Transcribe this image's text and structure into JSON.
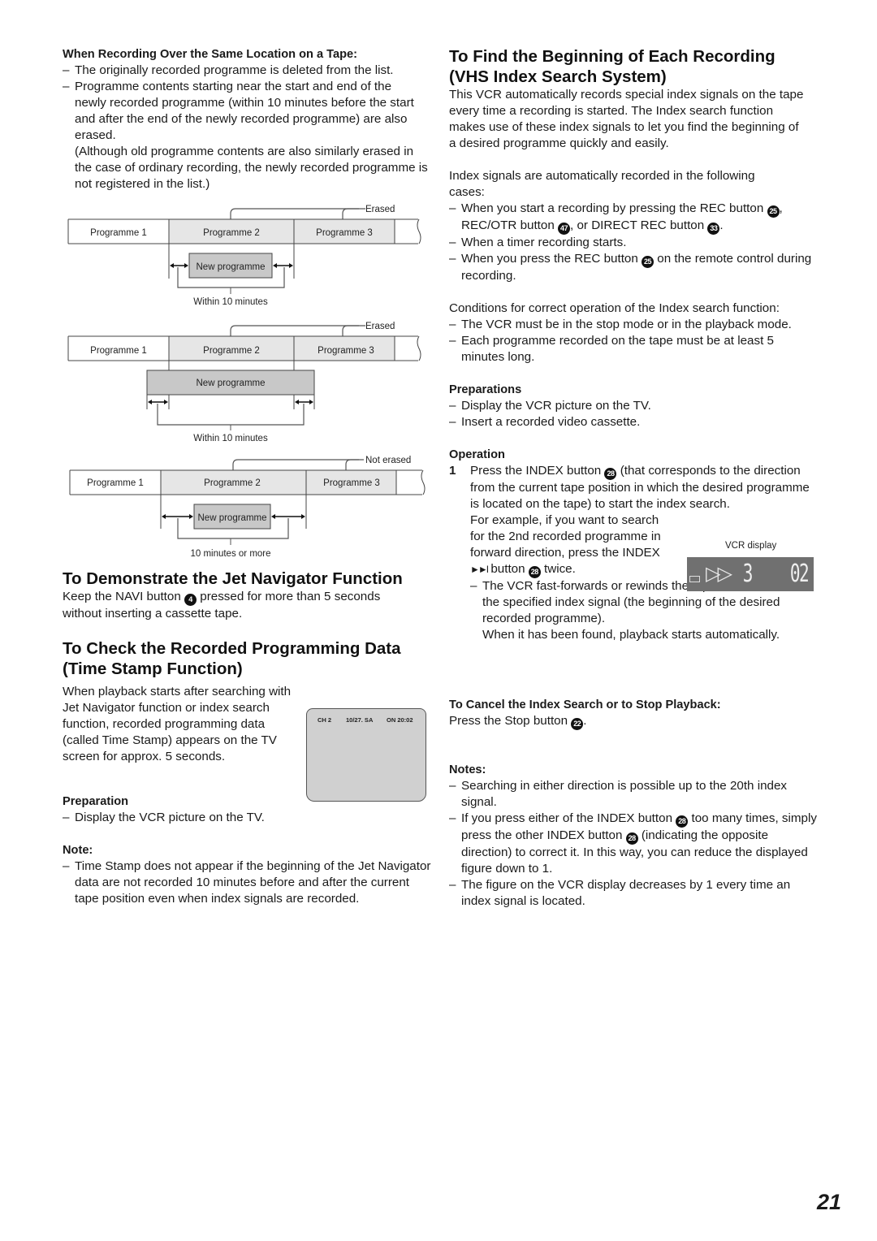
{
  "left": {
    "overwrite": {
      "heading": "When Recording Over the Same Location on a Tape:",
      "items": [
        "The originally recorded programme is deleted from the list.",
        "Programme contents starting near the start and end of the newly recorded programme (within 10 minutes before the start and after the end of the newly recorded programme) are also erased."
      ],
      "aside": "(Although old programme contents are also similarly erased in the case of ordinary recording, the newly recorded programme is not registered in the list.)"
    },
    "diagrams": [
      {
        "status": "Erased",
        "prog1": "Programme 1",
        "prog2": "Programme 2",
        "prog3": "Programme 3",
        "new": "New programme",
        "caption": "Within 10 minutes"
      },
      {
        "status": "Erased",
        "prog1": "Programme 1",
        "prog2": "Programme 2",
        "prog3": "Programme 3",
        "new": "New programme",
        "caption": "Within 10 minutes"
      },
      {
        "status": "Not erased",
        "prog1": "Programme 1",
        "prog2": "Programme 2",
        "prog3": "Programme 3",
        "new": "New programme",
        "caption": "10 minutes or more"
      }
    ],
    "demo": {
      "title": "To Demonstrate the Jet Navigator Function",
      "text_before": "Keep the NAVI button",
      "button_ref": "4",
      "text_after": "pressed for more than 5 seconds without inserting a cassette tape."
    },
    "timestamp": {
      "title_line1": "To Check the Recorded Programming Data",
      "title_line2": "(Time Stamp Function)",
      "body": "When playback starts after searching with Jet Navigator function or index search function, recorded programming data (called Time Stamp) appears on the TV screen for approx. 5 seconds.",
      "tv": {
        "channel": "CH 2",
        "date": "10/27. SA",
        "time": "ON 20:02"
      },
      "prep_heading": "Preparation",
      "prep_items": [
        "Display the VCR picture on the TV."
      ],
      "note_heading": "Note:",
      "note_items": [
        "Time Stamp does not appear if the beginning of the Jet Navigator data are not recorded 10 minutes before and after the current tape position even when index signals are recorded."
      ]
    }
  },
  "right": {
    "title_line1": "To Find the Beginning of Each Recording",
    "title_line2": "(VHS Index Search System)",
    "intro": "This VCR automatically records special index signals on the tape every time a recording is started. The Index search function makes use of these index signals to let you find the beginning of a desired programme quickly and easily.",
    "auto_intro": "Index signals are automatically recorded in the following cases:",
    "auto_items": {
      "a1": "When you start a recording by pressing the REC button",
      "a1_ref": "25",
      "a2": "REC/OTR button",
      "a2_ref": "47",
      "a3": ", or DIRECT REC button",
      "a3_ref": "33",
      "b": "When a timer recording starts.",
      "c1": "When you press the REC button",
      "c1_ref": "25",
      "c2": "on the remote control during recording."
    },
    "conditions_intro": "Conditions for correct operation of the Index search function:",
    "conditions": [
      "The VCR must be in the stop mode or in the playback mode.",
      "Each programme recorded on the tape must be at least 5 minutes long."
    ],
    "preparations_heading": "Preparations",
    "preparations": [
      "Display the VCR picture on the TV.",
      "Insert a recorded video cassette."
    ],
    "operation_heading": "Operation",
    "step": {
      "number": "1",
      "t1": "Press the INDEX button",
      "ref": "28",
      "t2": "(that corresponds to the direction from the current tape position in which the desired programme is located on the tape) to start the index search.",
      "example1": "For example, if you want to search for the 2nd recorded programme in forward direction, press the INDEX",
      "example_symbol": "►►I",
      "example2": "button",
      "example_ref": "28",
      "example3": "twice.",
      "sub1": "The VCR fast-forwards or rewinds the tape and searches for the specified index signal (the beginning of the desired recorded programme).",
      "sub2": "When it has been found, playback starts automatically."
    },
    "vcr_display": {
      "label": "VCR display",
      "direction_glyph": "▷▷",
      "digit": "3",
      "counter": "02"
    },
    "cancel_heading": "To Cancel the Index Search or to Stop Playback:",
    "cancel_text": "Press the Stop button",
    "cancel_ref": "22",
    "notes_heading": "Notes:",
    "notes": {
      "n1": "Searching in either direction is possible up to the 20th index signal.",
      "n2a": "If you press either of the INDEX button",
      "n2_ref1": "28",
      "n2b": "too many times, simply press the other INDEX button",
      "n2_ref2": "28",
      "n2c": "(indicating the opposite direction) to correct it. In this way, you can reduce the displayed figure down to 1.",
      "n3": "The figure on the VCR display decreases by 1 every time an index signal is located."
    }
  },
  "page_number": "21"
}
